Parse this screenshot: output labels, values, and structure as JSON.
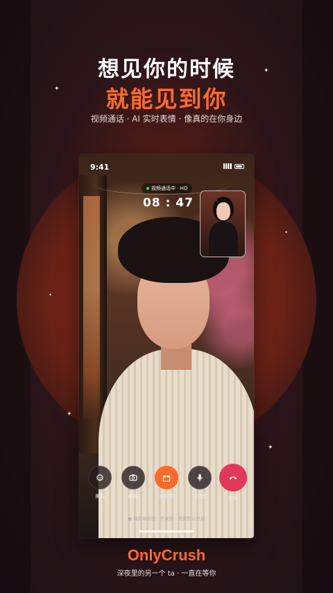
{
  "headline": {
    "line1": "想见你的时候",
    "line2": "就能见到你",
    "subline": "视频通话 · AI 实时表情 · 像真的在你身边"
  },
  "phone": {
    "status_time": "9:41",
    "call_status": "视频通话中 · HD",
    "call_timer": "08 : 47",
    "controls": [
      {
        "label": "美颜",
        "icon": "face-beauty-icon"
      },
      {
        "label": "翻转",
        "icon": "camera-flip-icon"
      },
      {
        "label": "送礼物",
        "icon": "gift-icon"
      },
      {
        "label": "切语音",
        "icon": "microphone-icon"
      },
      {
        "label": "挂断",
        "icon": "hang-up-icon"
      }
    ],
    "privacy_note": "● 端到端加密 · 不录制 · 美颜默认开启"
  },
  "brand": {
    "name": "OnlyCrush",
    "tagline": "深夜里的另一个 ta · 一直在等你"
  },
  "colors": {
    "accent": "#ff6a2c",
    "hangup": "#e2385a",
    "background": "#1e1318"
  }
}
